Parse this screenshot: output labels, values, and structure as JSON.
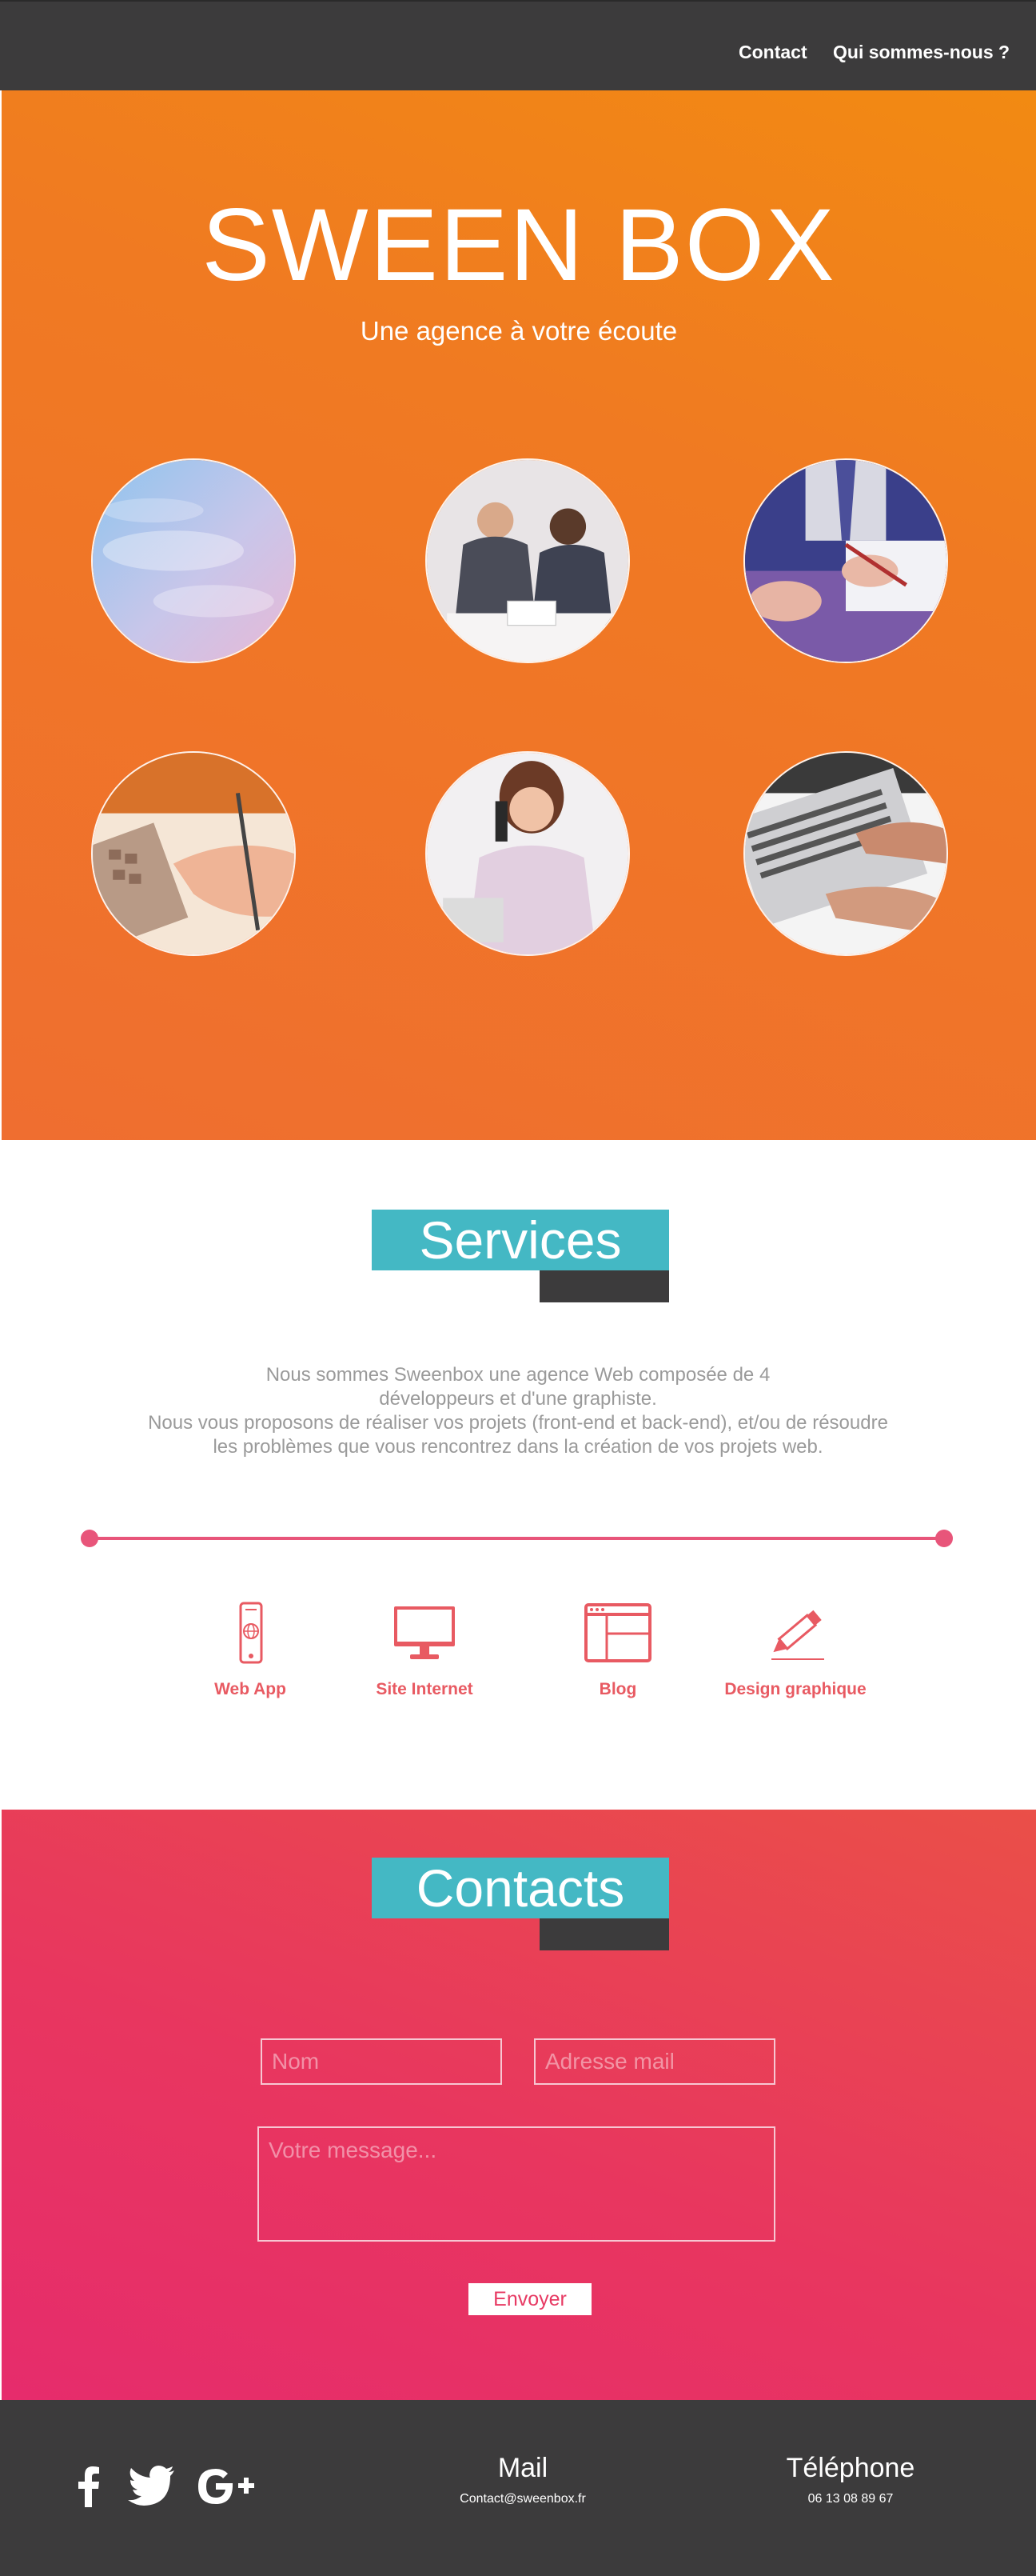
{
  "nav": {
    "items": [
      {
        "label": "Contact"
      },
      {
        "label": "Qui sommes-nous ?"
      }
    ]
  },
  "hero": {
    "title": "SWEEN BOX",
    "subtitle": "Une agence à votre écoute"
  },
  "services": {
    "title": "Services",
    "description": [
      "Nous sommes Sweenbox une agence Web composée de 4",
      "développeurs et d'une graphiste.",
      "Nous vous proposons de réaliser vos projets (front-end et back-end), et/ou de résoudre",
      "les problèmes que vous rencontrez dans la création de vos projets web."
    ],
    "items": [
      {
        "label": "Web App",
        "icon": "smartphone-globe-icon"
      },
      {
        "label": "Site Internet",
        "icon": "monitor-icon"
      },
      {
        "label": "Blog",
        "icon": "browser-window-icon"
      },
      {
        "label": "Design graphique",
        "icon": "pencil-icon"
      }
    ]
  },
  "contacts": {
    "title": "Contacts",
    "form": {
      "name_placeholder": "Nom",
      "email_placeholder": "Adresse mail",
      "message_placeholder": "Votre message...",
      "submit_label": "Envoyer"
    }
  },
  "footer": {
    "social": [
      "facebook-icon",
      "twitter-icon",
      "google-plus-icon"
    ],
    "mail": {
      "heading": "Mail",
      "value": "Contact@sweenbox.fr"
    },
    "phone": {
      "heading": "Téléphone",
      "value": "06 13 08 89 67"
    }
  },
  "colors": {
    "nav": "#3c3b3c",
    "hero_orange": "#f07a22",
    "accent_teal": "#44b8c4",
    "accent_pink": "#e8557a",
    "contact_gradient": "#e62c6c"
  }
}
